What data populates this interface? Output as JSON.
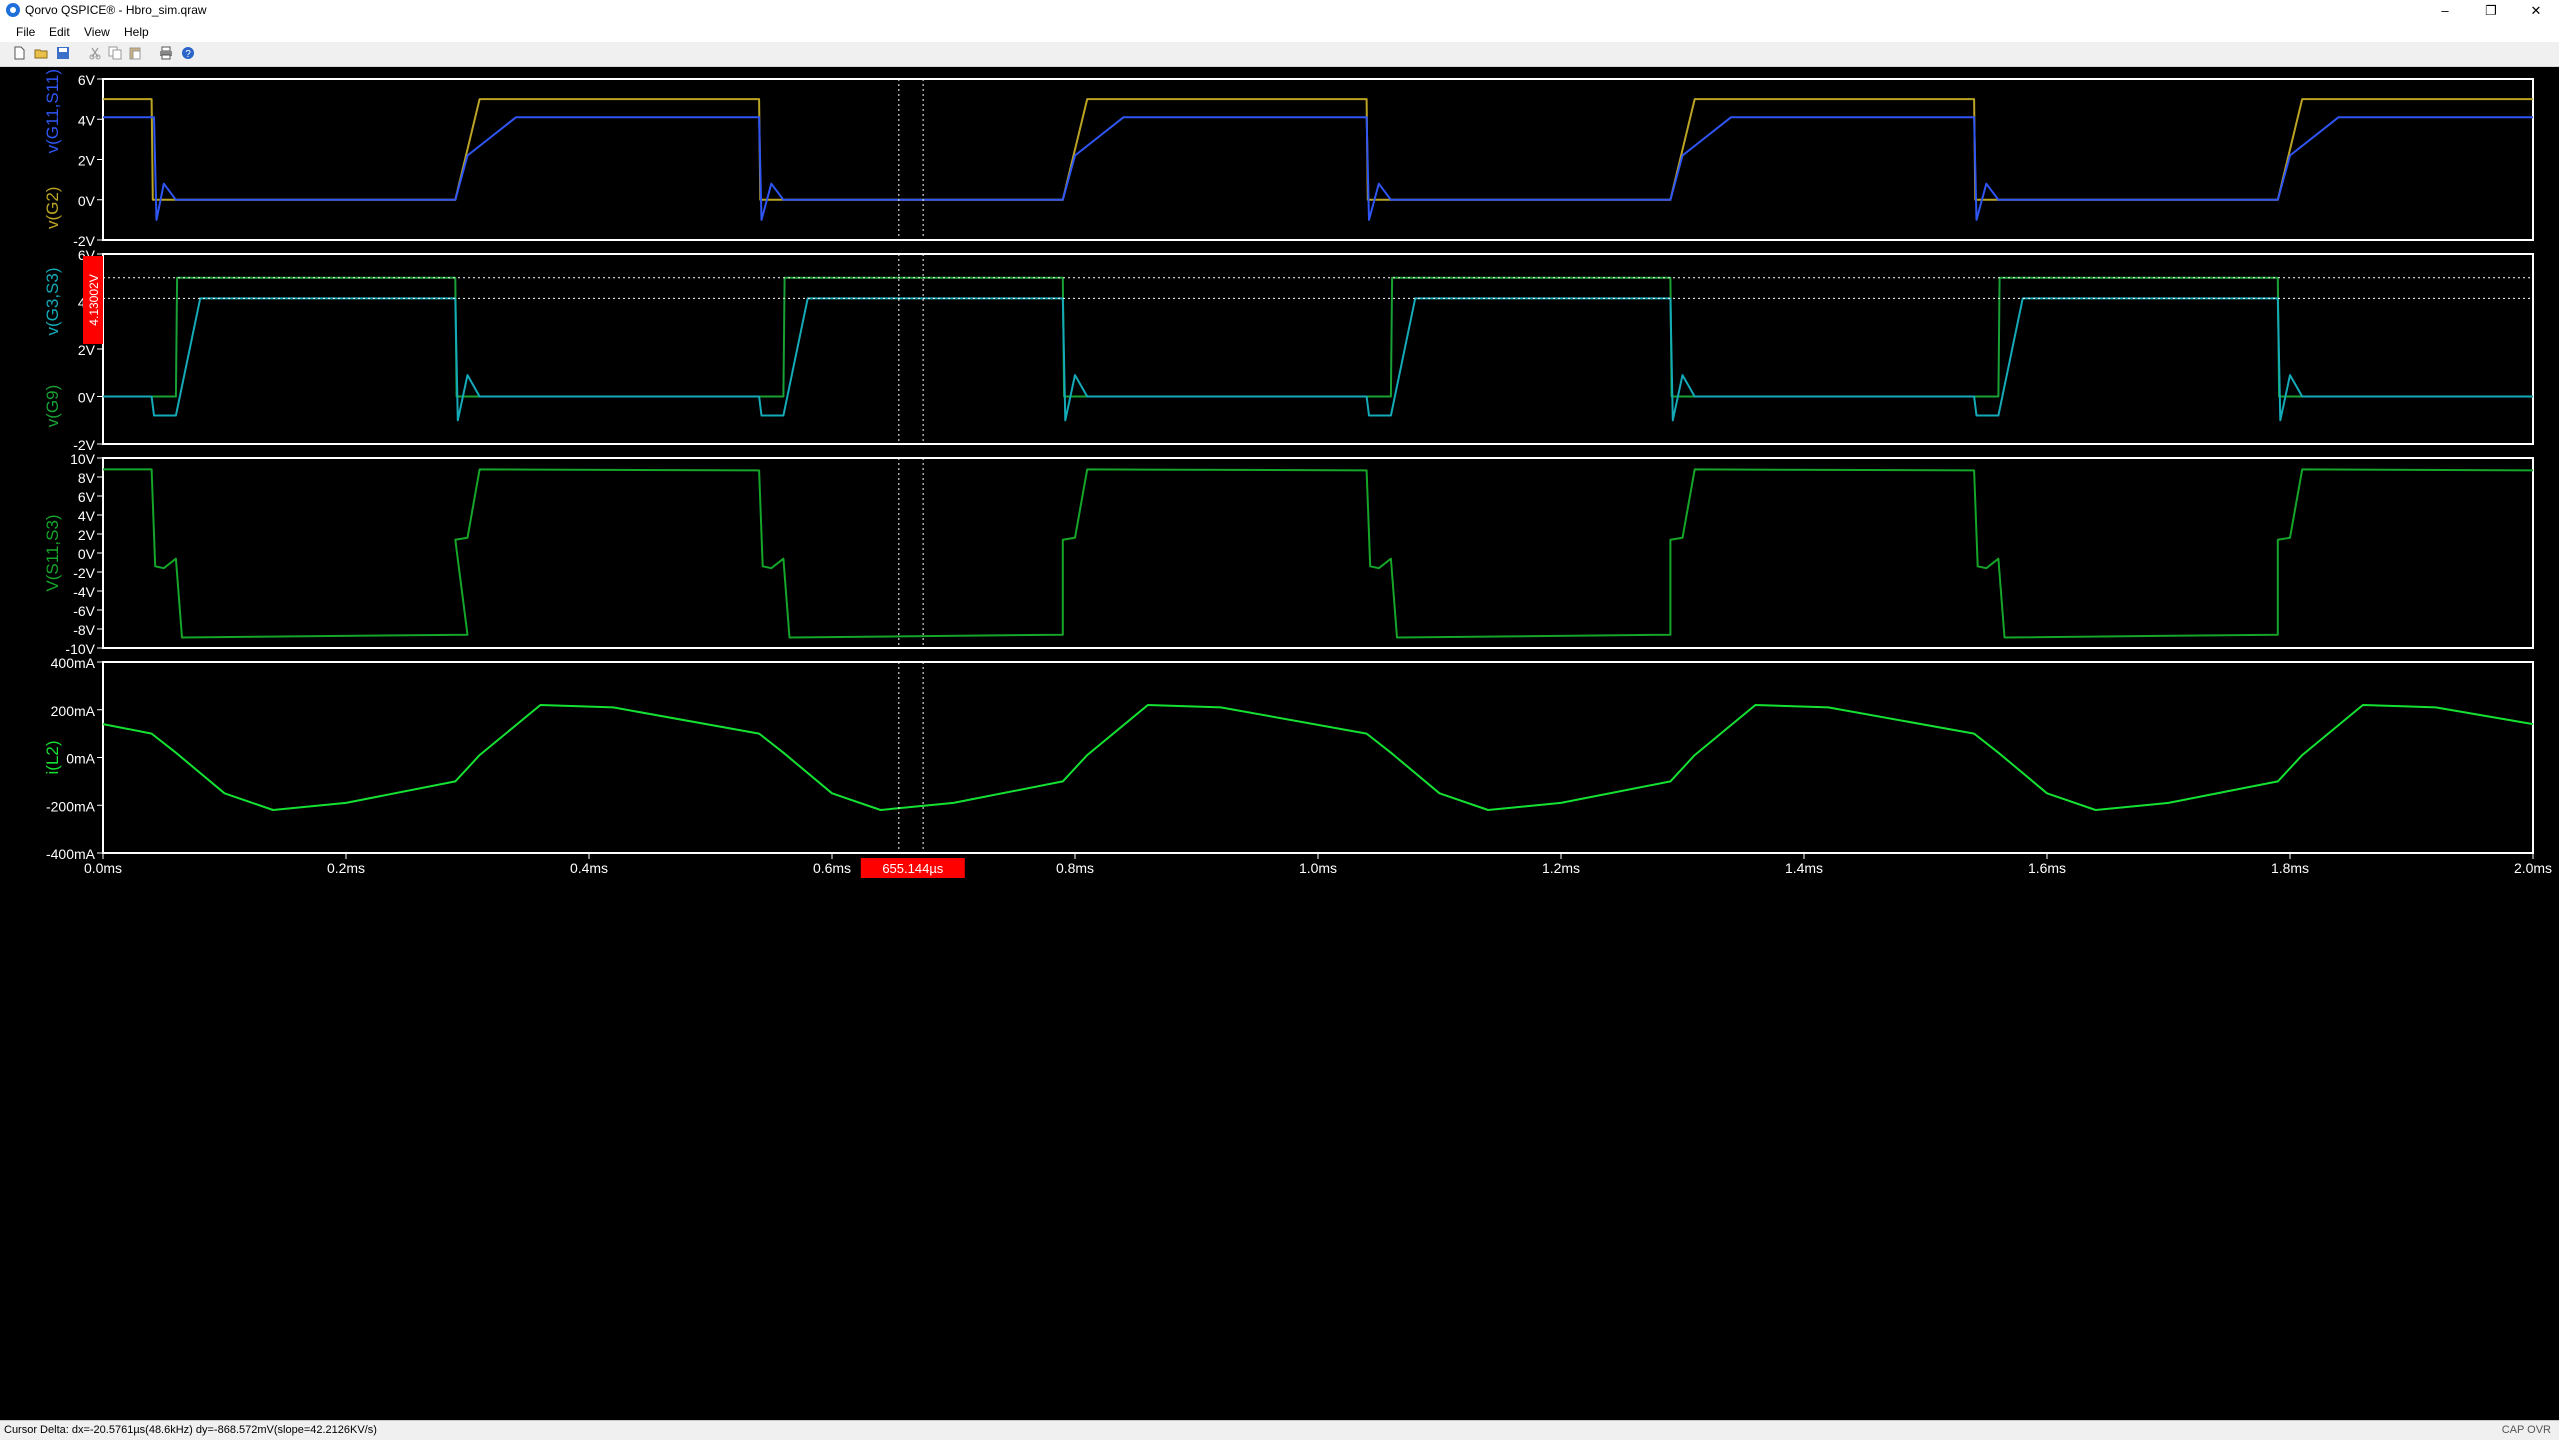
{
  "app": {
    "title": "Qorvo QSPICE® - Hbro_sim.qraw",
    "window_controls": [
      "–",
      "❐",
      "✕"
    ]
  },
  "menu": [
    "File",
    "Edit",
    "View",
    "Help"
  ],
  "toolbar_icons": [
    "new-icon",
    "open-icon",
    "save-icon",
    "cut-icon",
    "copy-icon",
    "paste-icon",
    "print-icon",
    "help-icon"
  ],
  "colors": {
    "plot_bg": "#000000",
    "border": "#ffffff",
    "axis_text": "#ffffff",
    "v_g2": "#bba424",
    "v_g11_s11": "#2f56f5",
    "v_g9": "#19a135",
    "v_g3_s3": "#14aab8",
    "v_s11_s3": "#14a529",
    "i_l2": "#14e132",
    "cursor": "#ffffff",
    "marker": "#ff0000"
  },
  "panes": [
    {
      "traces": [
        "v(G11,S11)",
        "v(G2)"
      ],
      "ytick_labels": [
        "6V",
        "4V",
        "2V",
        "0V",
        "-2V"
      ]
    },
    {
      "traces": [
        "v(G3,S3)",
        "v(G9)"
      ],
      "ytick_labels": [
        "6V",
        "4V",
        "2V",
        "0V",
        "-2V"
      ],
      "cursor_marker": "4.13002V"
    },
    {
      "traces": [
        "V(S11,S3)"
      ],
      "ytick_labels": [
        "10V",
        "8V",
        "6V",
        "4V",
        "2V",
        "0V",
        "-2V",
        "-4V",
        "-6V",
        "-8V",
        "-10V"
      ]
    },
    {
      "traces": [
        "i(L2)"
      ],
      "ytick_labels": [
        "400mA",
        "200mA",
        "0mA",
        "-200mA",
        "-400mA"
      ]
    }
  ],
  "xaxis": {
    "ticks": [
      "0.0ms",
      "0.2ms",
      "0.4ms",
      "0.6ms",
      "0.8ms",
      "1.0ms",
      "1.2ms",
      "1.4ms",
      "1.6ms",
      "1.8ms",
      "2.0ms"
    ],
    "cursor_marker": "655.144µs"
  },
  "status": {
    "cursor_delta": "Cursor Delta: dx=-20.5761µs(48.6kHz)  dy=-868.572mV(slope=42.2126KV/s)",
    "indicators": "CAP  OVR"
  },
  "chart_data": [
    {
      "type": "line",
      "x_unit": "ms",
      "xlim": [
        0,
        2.0
      ],
      "ylim": [
        -2,
        6
      ],
      "ylabels": [
        "v(G11,S11)",
        "v(G2)"
      ],
      "series": [
        {
          "name": "v(G2)",
          "x": [
            0,
            0.04,
            0.041,
            0.29,
            0.31,
            0.54,
            0.541,
            0.79,
            0.81,
            1.04,
            1.041,
            1.29,
            1.31,
            1.54,
            1.541,
            1.79,
            1.81,
            2.0
          ],
          "y": [
            5,
            5,
            0,
            0,
            5,
            5,
            0,
            0,
            5,
            5,
            0,
            0,
            5,
            5,
            0,
            0,
            5,
            5
          ]
        },
        {
          "name": "v(G11,S11)",
          "x": [
            0,
            0.042,
            0.044,
            0.05,
            0.06,
            0.29,
            0.3,
            0.34,
            0.54,
            0.542,
            0.55,
            0.56,
            0.79,
            0.8,
            0.84,
            1.04,
            1.042,
            1.05,
            1.06,
            1.29,
            1.3,
            1.34,
            1.54,
            1.542,
            1.55,
            1.56,
            1.79,
            1.8,
            1.84,
            2.0
          ],
          "y": [
            4.1,
            4.1,
            -1,
            0.8,
            0,
            0,
            2.2,
            4.1,
            4.1,
            -1,
            0.8,
            0,
            0,
            2.2,
            4.1,
            4.1,
            -1,
            0.8,
            0,
            0,
            2.2,
            4.1,
            4.1,
            -1,
            0.8,
            0,
            0,
            2.2,
            4.1,
            4.1
          ]
        }
      ]
    },
    {
      "type": "line",
      "x_unit": "ms",
      "xlim": [
        0,
        2.0
      ],
      "ylim": [
        -2,
        6
      ],
      "ylabels": [
        "v(G3,S3)",
        "v(G9)"
      ],
      "series": [
        {
          "name": "v(G9)",
          "x": [
            0,
            0.06,
            0.061,
            0.29,
            0.291,
            0.56,
            0.561,
            0.79,
            0.791,
            1.06,
            1.061,
            1.29,
            1.291,
            1.56,
            1.561,
            1.79,
            1.791,
            2.0
          ],
          "y": [
            0,
            0,
            5,
            5,
            0,
            0,
            5,
            5,
            0,
            0,
            5,
            5,
            0,
            0,
            5,
            5,
            0,
            0
          ]
        },
        {
          "name": "v(G3,S3)",
          "x": [
            0,
            0.04,
            0.042,
            0.06,
            0.08,
            0.1,
            0.29,
            0.292,
            0.3,
            0.31,
            0.54,
            0.542,
            0.56,
            0.58,
            0.6,
            0.79,
            0.792,
            0.8,
            0.81,
            1.04,
            1.042,
            1.06,
            1.08,
            1.1,
            1.29,
            1.292,
            1.3,
            1.31,
            1.54,
            1.542,
            1.56,
            1.58,
            1.6,
            1.79,
            1.792,
            1.8,
            1.81,
            2.0
          ],
          "y": [
            0,
            0,
            -0.8,
            -0.8,
            4.13,
            4.13,
            4.13,
            -1,
            0.9,
            0,
            0,
            -0.8,
            -0.8,
            4.13,
            4.13,
            4.13,
            -1,
            0.9,
            0,
            0,
            -0.8,
            -0.8,
            4.13,
            4.13,
            4.13,
            -1,
            0.9,
            0,
            0,
            -0.8,
            -0.8,
            4.13,
            4.13,
            4.13,
            -1,
            0.9,
            0,
            0
          ]
        }
      ]
    },
    {
      "type": "line",
      "x_unit": "ms",
      "xlim": [
        0,
        2.0
      ],
      "ylim": [
        -10,
        10
      ],
      "ylabels": [
        "V(S11,S3)"
      ],
      "series": [
        {
          "name": "V(S11,S3)",
          "x": [
            0,
            0.04,
            0.043,
            0.05,
            0.06,
            0.065,
            0.3,
            0.29,
            0.3,
            0.31,
            0.54,
            0.543,
            0.55,
            0.56,
            0.565,
            0.79,
            0.79,
            0.8,
            0.81,
            1.04,
            1.043,
            1.05,
            1.06,
            1.065,
            1.29,
            1.29,
            1.3,
            1.31,
            1.54,
            1.543,
            1.55,
            1.56,
            1.565,
            1.79,
            1.79,
            1.8,
            1.81,
            2.0
          ],
          "y": [
            8.8,
            8.8,
            -1.4,
            -1.6,
            -0.6,
            -8.9,
            -8.6,
            1.4,
            1.6,
            8.8,
            8.7,
            -1.4,
            -1.6,
            -0.6,
            -8.9,
            -8.6,
            1.4,
            1.6,
            8.8,
            8.7,
            -1.4,
            -1.6,
            -0.6,
            -8.9,
            -8.6,
            1.4,
            1.6,
            8.8,
            8.7,
            -1.4,
            -1.6,
            -0.6,
            -8.9,
            -8.6,
            1.4,
            1.6,
            8.8,
            8.7
          ]
        }
      ]
    },
    {
      "type": "line",
      "x_unit": "ms",
      "xlim": [
        0,
        2.0
      ],
      "ylim": [
        -400,
        400
      ],
      "y_unit": "mA",
      "ylabels": [
        "i(L2)"
      ],
      "series": [
        {
          "name": "i(L2)",
          "x": [
            0,
            0.04,
            0.06,
            0.1,
            0.14,
            0.2,
            0.29,
            0.31,
            0.36,
            0.42,
            0.54,
            0.56,
            0.6,
            0.64,
            0.7,
            0.79,
            0.81,
            0.86,
            0.92,
            1.04,
            1.06,
            1.1,
            1.14,
            1.2,
            1.29,
            1.31,
            1.36,
            1.42,
            1.54,
            1.56,
            1.6,
            1.64,
            1.7,
            1.79,
            1.81,
            1.86,
            1.92,
            2.0
          ],
          "y": [
            140,
            100,
            20,
            -150,
            -220,
            -190,
            -100,
            10,
            220,
            210,
            100,
            20,
            -150,
            -220,
            -190,
            -100,
            10,
            220,
            210,
            100,
            20,
            -150,
            -220,
            -190,
            -100,
            10,
            220,
            210,
            100,
            20,
            -150,
            -220,
            -190,
            -100,
            10,
            220,
            210,
            140
          ]
        }
      ]
    }
  ]
}
